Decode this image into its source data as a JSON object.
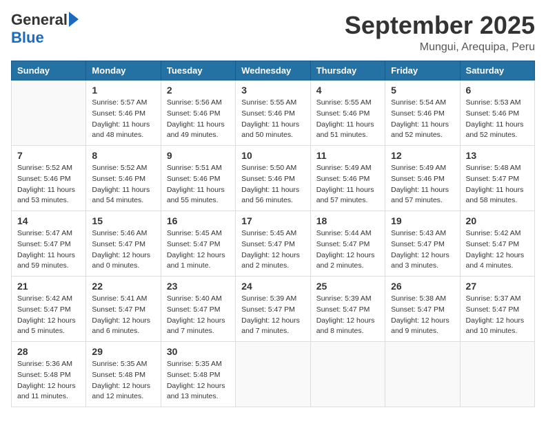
{
  "logo": {
    "general": "General",
    "blue": "Blue"
  },
  "title": "September 2025",
  "location": "Mungui, Arequipa, Peru",
  "days_of_week": [
    "Sunday",
    "Monday",
    "Tuesday",
    "Wednesday",
    "Thursday",
    "Friday",
    "Saturday"
  ],
  "weeks": [
    [
      {
        "day": "",
        "sunrise": "",
        "sunset": "",
        "daylight": ""
      },
      {
        "day": "1",
        "sunrise": "Sunrise: 5:57 AM",
        "sunset": "Sunset: 5:46 PM",
        "daylight": "Daylight: 11 hours and 48 minutes."
      },
      {
        "day": "2",
        "sunrise": "Sunrise: 5:56 AM",
        "sunset": "Sunset: 5:46 PM",
        "daylight": "Daylight: 11 hours and 49 minutes."
      },
      {
        "day": "3",
        "sunrise": "Sunrise: 5:55 AM",
        "sunset": "Sunset: 5:46 PM",
        "daylight": "Daylight: 11 hours and 50 minutes."
      },
      {
        "day": "4",
        "sunrise": "Sunrise: 5:55 AM",
        "sunset": "Sunset: 5:46 PM",
        "daylight": "Daylight: 11 hours and 51 minutes."
      },
      {
        "day": "5",
        "sunrise": "Sunrise: 5:54 AM",
        "sunset": "Sunset: 5:46 PM",
        "daylight": "Daylight: 11 hours and 52 minutes."
      },
      {
        "day": "6",
        "sunrise": "Sunrise: 5:53 AM",
        "sunset": "Sunset: 5:46 PM",
        "daylight": "Daylight: 11 hours and 52 minutes."
      }
    ],
    [
      {
        "day": "7",
        "sunrise": "Sunrise: 5:52 AM",
        "sunset": "Sunset: 5:46 PM",
        "daylight": "Daylight: 11 hours and 53 minutes."
      },
      {
        "day": "8",
        "sunrise": "Sunrise: 5:52 AM",
        "sunset": "Sunset: 5:46 PM",
        "daylight": "Daylight: 11 hours and 54 minutes."
      },
      {
        "day": "9",
        "sunrise": "Sunrise: 5:51 AM",
        "sunset": "Sunset: 5:46 PM",
        "daylight": "Daylight: 11 hours and 55 minutes."
      },
      {
        "day": "10",
        "sunrise": "Sunrise: 5:50 AM",
        "sunset": "Sunset: 5:46 PM",
        "daylight": "Daylight: 11 hours and 56 minutes."
      },
      {
        "day": "11",
        "sunrise": "Sunrise: 5:49 AM",
        "sunset": "Sunset: 5:46 PM",
        "daylight": "Daylight: 11 hours and 57 minutes."
      },
      {
        "day": "12",
        "sunrise": "Sunrise: 5:49 AM",
        "sunset": "Sunset: 5:46 PM",
        "daylight": "Daylight: 11 hours and 57 minutes."
      },
      {
        "day": "13",
        "sunrise": "Sunrise: 5:48 AM",
        "sunset": "Sunset: 5:47 PM",
        "daylight": "Daylight: 11 hours and 58 minutes."
      }
    ],
    [
      {
        "day": "14",
        "sunrise": "Sunrise: 5:47 AM",
        "sunset": "Sunset: 5:47 PM",
        "daylight": "Daylight: 11 hours and 59 minutes."
      },
      {
        "day": "15",
        "sunrise": "Sunrise: 5:46 AM",
        "sunset": "Sunset: 5:47 PM",
        "daylight": "Daylight: 12 hours and 0 minutes."
      },
      {
        "day": "16",
        "sunrise": "Sunrise: 5:45 AM",
        "sunset": "Sunset: 5:47 PM",
        "daylight": "Daylight: 12 hours and 1 minute."
      },
      {
        "day": "17",
        "sunrise": "Sunrise: 5:45 AM",
        "sunset": "Sunset: 5:47 PM",
        "daylight": "Daylight: 12 hours and 2 minutes."
      },
      {
        "day": "18",
        "sunrise": "Sunrise: 5:44 AM",
        "sunset": "Sunset: 5:47 PM",
        "daylight": "Daylight: 12 hours and 2 minutes."
      },
      {
        "day": "19",
        "sunrise": "Sunrise: 5:43 AM",
        "sunset": "Sunset: 5:47 PM",
        "daylight": "Daylight: 12 hours and 3 minutes."
      },
      {
        "day": "20",
        "sunrise": "Sunrise: 5:42 AM",
        "sunset": "Sunset: 5:47 PM",
        "daylight": "Daylight: 12 hours and 4 minutes."
      }
    ],
    [
      {
        "day": "21",
        "sunrise": "Sunrise: 5:42 AM",
        "sunset": "Sunset: 5:47 PM",
        "daylight": "Daylight: 12 hours and 5 minutes."
      },
      {
        "day": "22",
        "sunrise": "Sunrise: 5:41 AM",
        "sunset": "Sunset: 5:47 PM",
        "daylight": "Daylight: 12 hours and 6 minutes."
      },
      {
        "day": "23",
        "sunrise": "Sunrise: 5:40 AM",
        "sunset": "Sunset: 5:47 PM",
        "daylight": "Daylight: 12 hours and 7 minutes."
      },
      {
        "day": "24",
        "sunrise": "Sunrise: 5:39 AM",
        "sunset": "Sunset: 5:47 PM",
        "daylight": "Daylight: 12 hours and 7 minutes."
      },
      {
        "day": "25",
        "sunrise": "Sunrise: 5:39 AM",
        "sunset": "Sunset: 5:47 PM",
        "daylight": "Daylight: 12 hours and 8 minutes."
      },
      {
        "day": "26",
        "sunrise": "Sunrise: 5:38 AM",
        "sunset": "Sunset: 5:47 PM",
        "daylight": "Daylight: 12 hours and 9 minutes."
      },
      {
        "day": "27",
        "sunrise": "Sunrise: 5:37 AM",
        "sunset": "Sunset: 5:47 PM",
        "daylight": "Daylight: 12 hours and 10 minutes."
      }
    ],
    [
      {
        "day": "28",
        "sunrise": "Sunrise: 5:36 AM",
        "sunset": "Sunset: 5:48 PM",
        "daylight": "Daylight: 12 hours and 11 minutes."
      },
      {
        "day": "29",
        "sunrise": "Sunrise: 5:35 AM",
        "sunset": "Sunset: 5:48 PM",
        "daylight": "Daylight: 12 hours and 12 minutes."
      },
      {
        "day": "30",
        "sunrise": "Sunrise: 5:35 AM",
        "sunset": "Sunset: 5:48 PM",
        "daylight": "Daylight: 12 hours and 13 minutes."
      },
      {
        "day": "",
        "sunrise": "",
        "sunset": "",
        "daylight": ""
      },
      {
        "day": "",
        "sunrise": "",
        "sunset": "",
        "daylight": ""
      },
      {
        "day": "",
        "sunrise": "",
        "sunset": "",
        "daylight": ""
      },
      {
        "day": "",
        "sunrise": "",
        "sunset": "",
        "daylight": ""
      }
    ]
  ]
}
